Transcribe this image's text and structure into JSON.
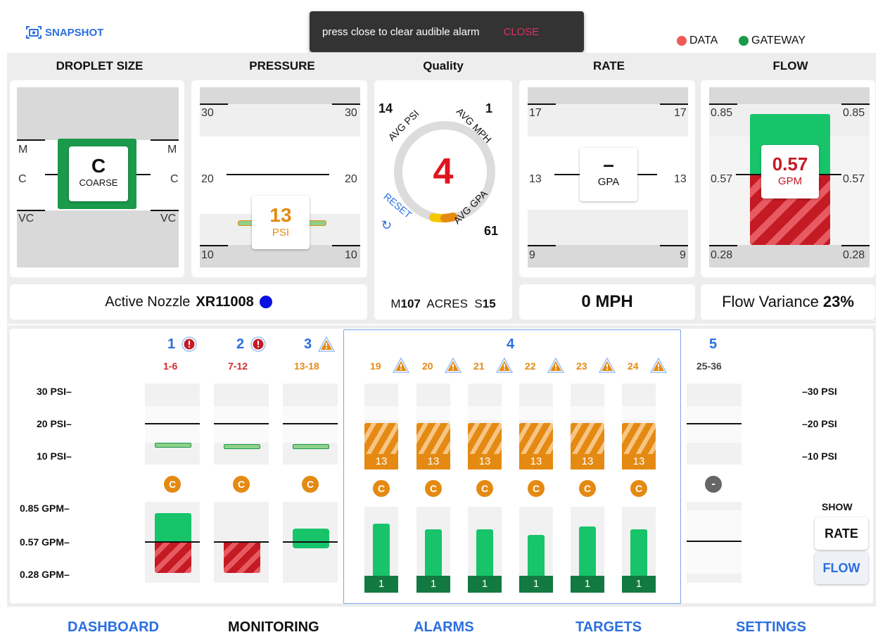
{
  "header": {
    "snapshot_label": "SNAPSHOT"
  },
  "toast": {
    "message": "press close to clear audible alarm",
    "close_label": "CLOSE"
  },
  "status": {
    "data_label": "DATA",
    "gateway_label": "GATEWAY",
    "data_color": "#f05a5a",
    "gateway_color": "#1a9a4a"
  },
  "panels": {
    "droplet": {
      "title": "DROPLET SIZE",
      "labels": [
        "M",
        "C",
        "VC"
      ],
      "value": "C",
      "unit": "COARSE"
    },
    "pressure": {
      "title": "PRESSURE",
      "top": "30",
      "mid": "20",
      "bottom": "10",
      "value": "13",
      "unit": "PSI"
    },
    "quality": {
      "title": "Quality",
      "value": "4",
      "avg_psi_val": "14",
      "avg_psi_label": "AVG PSI",
      "avg_mph_val": "1",
      "avg_mph_label": "AVG MPH",
      "avg_gpa_val": "61",
      "avg_gpa_label": "AVG GPA",
      "reset_label": "RESET",
      "m_label": "M",
      "m_val": "107",
      "acres_label": "ACRES",
      "s_label": "S",
      "s_val": "15"
    },
    "rate": {
      "title": "RATE",
      "top": "17",
      "mid": "13",
      "bottom": "9",
      "value": "–",
      "unit": "GPA"
    },
    "flow": {
      "title": "FLOW",
      "top": "0.85",
      "mid": "0.57",
      "bottom": "0.28",
      "value": "0.57",
      "unit": "GPM"
    }
  },
  "footer_cards": {
    "nozzle_label": "Active Nozzle",
    "nozzle_value": "XR11008",
    "speed": "0 MPH",
    "variance_label": "Flow Variance",
    "variance_value": "23%"
  },
  "lower": {
    "psi_axis": [
      "30 PSI–",
      "20 PSI–",
      "10 PSI–"
    ],
    "psi_axis_right": [
      "–30 PSI",
      "–20 PSI",
      "–10 PSI"
    ],
    "gpm_axis": [
      "0.85 GPM–",
      "0.57 GPM–",
      "0.28 GPM–"
    ],
    "sections": [
      {
        "num": "1",
        "range": "1-6",
        "range_color": "#d32a2a",
        "alert": "error"
      },
      {
        "num": "2",
        "range": "7-12",
        "range_color": "#d32a2a",
        "alert": "error"
      },
      {
        "num": "3",
        "range": "13-18",
        "range_color": "#e48a12",
        "alert": "warning"
      },
      {
        "num": "4",
        "range": "",
        "alert": "none"
      },
      {
        "num": "5",
        "range": "25-36",
        "range_color": "#444",
        "alert": "none"
      }
    ],
    "nozzle_cols": [
      "19",
      "20",
      "21",
      "22",
      "23",
      "24"
    ],
    "nozzle_pressure": "13",
    "nozzle_count": "1",
    "droplet_badge": "C",
    "section5_badge": "-",
    "show_label": "SHOW",
    "rate_btn": "RATE",
    "flow_btn": "FLOW"
  },
  "nav": {
    "items": [
      "DASHBOARD",
      "MONITORING",
      "ALARMS",
      "TARGETS",
      "SETTINGS"
    ],
    "active": "MONITORING"
  }
}
